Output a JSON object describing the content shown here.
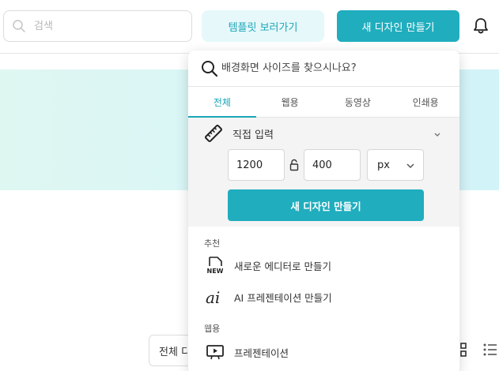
{
  "header": {
    "search_placeholder": "검색",
    "template_button": "템플릿 보러가기",
    "new_design_button": "새 디자인 만들기"
  },
  "background": {
    "filter_label": "전체 디"
  },
  "panel": {
    "search_placeholder": "배경화면 사이즈를 찾으시나요?",
    "tabs": [
      {
        "label": "전체",
        "active": true
      },
      {
        "label": "웹용",
        "active": false
      },
      {
        "label": "동영상",
        "active": false
      },
      {
        "label": "인쇄용",
        "active": false
      }
    ],
    "custom": {
      "title": "직접 입력",
      "width": "1200",
      "height": "400",
      "unit": "px",
      "create_label": "새 디자인 만들기"
    },
    "recommended": {
      "title": "추천",
      "items": [
        {
          "label": "새로운 에디터로 만들기",
          "icon": "new-badge-icon"
        },
        {
          "label": "AI 프레젠테이션 만들기",
          "icon": "ai-icon"
        }
      ]
    },
    "web": {
      "title": "웹용",
      "items": [
        {
          "label": "프레젠테이션",
          "icon": "presentation-icon"
        }
      ]
    }
  },
  "colors": {
    "accent": "#20aebf",
    "accent_text": "#1ba6b8",
    "accent_light": "#e7f8fb",
    "banner": "#d8f5f7"
  }
}
